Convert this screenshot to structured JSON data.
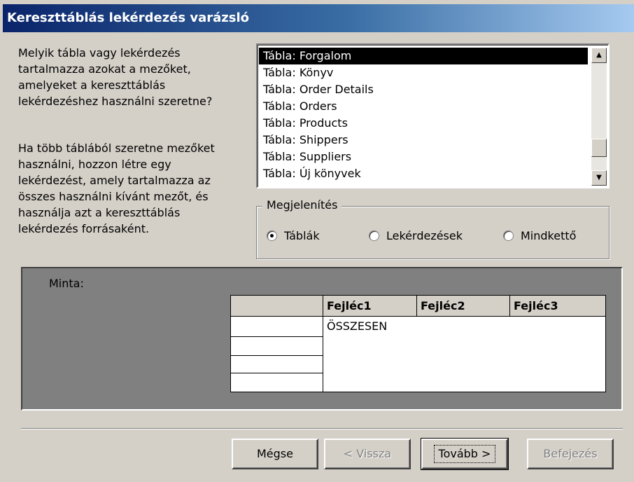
{
  "window": {
    "title": "Kereszttáblás lekérdezés varázsló"
  },
  "instructions": {
    "question": "Melyik tábla vagy lekérdezés\ntartalmazza azokat a mezőket,\namelyeket a kereszttáblás\nlekérdezéshez használni szeretne?",
    "hint": "Ha több táblából szeretne mezőket\nhasználni, hozzon létre egy\nlekérdezést, amely tartalmazza az\nösszes használni kívánt mezőt, és\nhasználja azt a kereszttáblás\nlekérdezés forrásaként."
  },
  "table_list": {
    "items": [
      {
        "label": "Tábla: Forgalom",
        "selected": true
      },
      {
        "label": "Tábla: Könyv",
        "selected": false
      },
      {
        "label": "Tábla: Order Details",
        "selected": false
      },
      {
        "label": "Tábla: Orders",
        "selected": false
      },
      {
        "label": "Tábla: Products",
        "selected": false
      },
      {
        "label": "Tábla: Shippers",
        "selected": false
      },
      {
        "label": "Tábla: Suppliers",
        "selected": false
      },
      {
        "label": "Tábla: Új könyvek",
        "selected": false
      }
    ],
    "scroll_position": 0.85
  },
  "display_group": {
    "label": "Megjelenítés",
    "options": {
      "tables": {
        "label": "Táblák",
        "checked": true
      },
      "queries": {
        "label": "Lekérdezések",
        "checked": false
      },
      "both": {
        "label": "Mindkettő",
        "checked": false
      }
    }
  },
  "sample": {
    "label": "Minta:",
    "headers": [
      "Fejléc1",
      "Fejléc2",
      "Fejléc3"
    ],
    "total_label": "ÖSSZESEN"
  },
  "buttons": {
    "cancel": "Mégse",
    "back": "< Vissza",
    "next": "Tovább >",
    "finish": "Befejezés"
  },
  "colors": {
    "title_start": "#0a246a",
    "title_end": "#a6caf0",
    "face": "#d4d0c8",
    "sample_panel": "#808080",
    "selection": "#000000"
  }
}
